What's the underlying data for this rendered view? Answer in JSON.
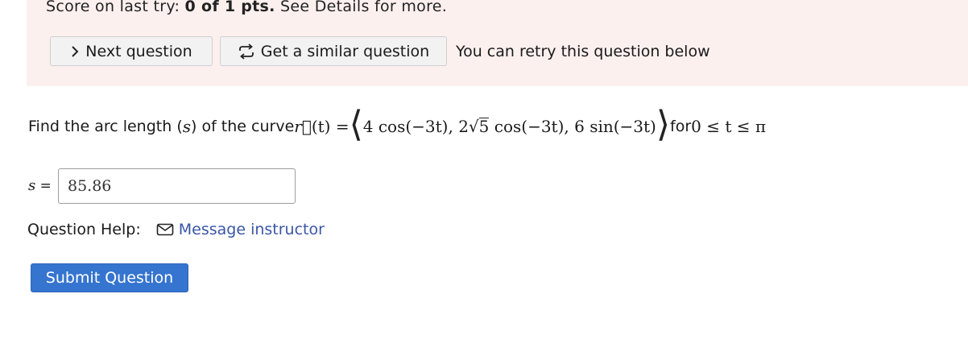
{
  "score": {
    "prefix": "Score on last try: ",
    "value": "0 of 1 pts.",
    "suffix": " See Details for more."
  },
  "actions": {
    "next_label": "Next question",
    "similar_label": "Get a similar question",
    "retry_text": "You can retry this question below"
  },
  "question": {
    "text_before": "Find the arc length (",
    "var_s": "s",
    "text_mid": ") of the curve ",
    "r_vec": "r⃗",
    "t_arg": "(t) = ",
    "comp1": "4 cos(−3t), 2",
    "sqrt_arg": "5",
    "comp2": " cos(−3t), 6 sin(−3t)",
    "text_for": " for ",
    "range": "0 ≤ t ≤ π"
  },
  "answer": {
    "label_var": "s",
    "label_eq": " = ",
    "value": "85.86"
  },
  "help": {
    "label": "Question Help:",
    "message_link": "Message instructor"
  },
  "submit": {
    "label": "Submit Question"
  },
  "colors": {
    "score_panel_bg": "#fcf0ef",
    "link": "#3a55a6",
    "submit_bg": "#3574cf"
  },
  "icons": {
    "next": "chevron-right-icon",
    "similar": "refresh-arrows-icon",
    "mail": "mail-icon"
  }
}
